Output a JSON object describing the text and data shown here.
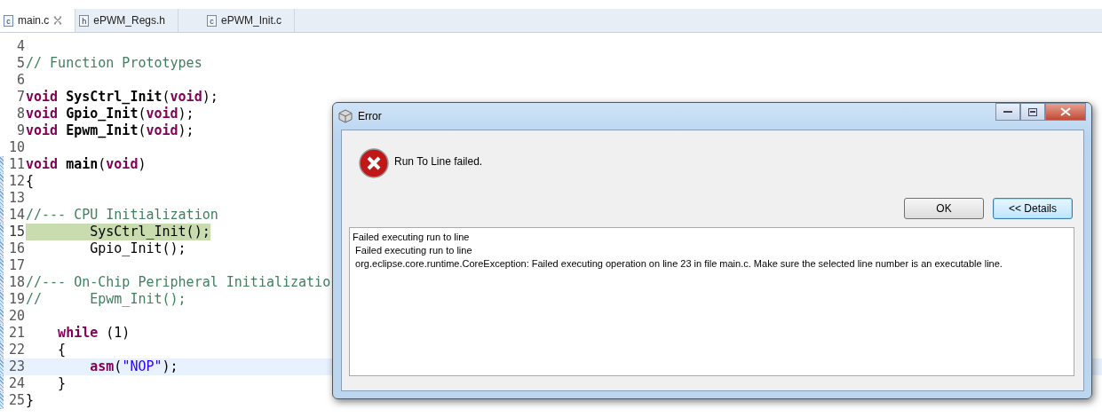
{
  "tabs": [
    {
      "label": "main.c",
      "icon_text": "c",
      "selected": true,
      "closable": true
    },
    {
      "label": "ePWM_Regs.h",
      "icon_text": "h",
      "selected": false,
      "closable": false
    },
    {
      "label": "ePWM_Init.c",
      "icon_text": "c",
      "selected": false,
      "closable": false
    }
  ],
  "editor": {
    "lines": [
      {
        "number": "4",
        "current_line": false,
        "cursor_line": false
      },
      {
        "number": "5",
        "current_line": false,
        "cursor_line": false,
        "segments": [
          {
            "text": "// Function Prototypes",
            "kind": "comment"
          }
        ]
      },
      {
        "number": "6",
        "current_line": false,
        "cursor_line": false
      },
      {
        "number": "7",
        "current_line": false,
        "cursor_line": false,
        "segments": [
          {
            "text": "void",
            "kind": "keyword"
          },
          {
            "text": " SysCtrl_Init",
            "kind": "function"
          },
          {
            "text": "(",
            "kind": "plain"
          },
          {
            "text": "void",
            "kind": "keyword"
          },
          {
            "text": ");",
            "kind": "plain"
          }
        ]
      },
      {
        "number": "8",
        "current_line": false,
        "cursor_line": false,
        "segments": [
          {
            "text": "void",
            "kind": "keyword"
          },
          {
            "text": " Gpio_Init",
            "kind": "function"
          },
          {
            "text": "(",
            "kind": "plain"
          },
          {
            "text": "void",
            "kind": "keyword"
          },
          {
            "text": ");",
            "kind": "plain"
          }
        ]
      },
      {
        "number": "9",
        "current_line": false,
        "cursor_line": false,
        "segments": [
          {
            "text": "void",
            "kind": "keyword"
          },
          {
            "text": " Epwm_Init",
            "kind": "function"
          },
          {
            "text": "(",
            "kind": "plain"
          },
          {
            "text": "void",
            "kind": "keyword"
          },
          {
            "text": ");",
            "kind": "plain"
          }
        ]
      },
      {
        "number": "10",
        "current_line": false,
        "cursor_line": false
      },
      {
        "number": "11",
        "current_line": false,
        "cursor_line": false,
        "segments": [
          {
            "text": "void",
            "kind": "keyword"
          },
          {
            "text": " main",
            "kind": "function"
          },
          {
            "text": "(",
            "kind": "plain"
          },
          {
            "text": "void",
            "kind": "keyword"
          },
          {
            "text": ")",
            "kind": "plain"
          }
        ]
      },
      {
        "number": "12",
        "current_line": false,
        "cursor_line": false,
        "segments": [
          {
            "text": "{",
            "kind": "plain"
          }
        ]
      },
      {
        "number": "13",
        "current_line": false,
        "cursor_line": false
      },
      {
        "number": "14",
        "current_line": false,
        "cursor_line": false,
        "segments": [
          {
            "text": "//--- CPU Initialization",
            "kind": "comment"
          }
        ]
      },
      {
        "number": "15",
        "current_line": true,
        "cursor_line": false,
        "segments": [
          {
            "text": "        SysCtrl_Init();",
            "kind": "plain"
          }
        ]
      },
      {
        "number": "16",
        "current_line": false,
        "cursor_line": false,
        "segments": [
          {
            "text": "        Gpio_Init();",
            "kind": "plain"
          }
        ]
      },
      {
        "number": "17",
        "current_line": false,
        "cursor_line": false
      },
      {
        "number": "18",
        "current_line": false,
        "cursor_line": false,
        "segments": [
          {
            "text": "//--- On-Chip Peripheral Initializatio",
            "kind": "comment"
          }
        ]
      },
      {
        "number": "19",
        "current_line": false,
        "cursor_line": false,
        "segments": [
          {
            "text": "//      Epwm_Init();",
            "kind": "comment"
          }
        ]
      },
      {
        "number": "20",
        "current_line": false,
        "cursor_line": false
      },
      {
        "number": "21",
        "current_line": false,
        "cursor_line": false,
        "segments": [
          {
            "text": "    while",
            "kind": "keyword"
          },
          {
            "text": " (1)",
            "kind": "plain"
          }
        ]
      },
      {
        "number": "22",
        "current_line": false,
        "cursor_line": false,
        "segments": [
          {
            "text": "    {",
            "kind": "plain"
          }
        ]
      },
      {
        "number": "23",
        "current_line": false,
        "cursor_line": true,
        "segments": [
          {
            "text": "        asm",
            "kind": "keyword"
          },
          {
            "text": "(",
            "kind": "plain"
          },
          {
            "text": "\"NOP\"",
            "kind": "string"
          },
          {
            "text": ");",
            "kind": "plain"
          }
        ]
      },
      {
        "number": "24",
        "current_line": false,
        "cursor_line": false,
        "segments": [
          {
            "text": "    }",
            "kind": "plain"
          }
        ]
      },
      {
        "number": "25",
        "current_line": false,
        "cursor_line": false,
        "segments": [
          {
            "text": "}",
            "kind": "plain"
          }
        ]
      }
    ]
  },
  "dialog": {
    "title": "Error",
    "message": "Run To Line failed.",
    "buttons": [
      {
        "label": "OK",
        "selected": false
      },
      {
        "label": "<< Details",
        "selected": true
      }
    ],
    "details": [
      "Failed executing run to line",
      " Failed executing run to line",
      " org.eclipse.core.runtime.CoreException: Failed executing operation on line 23 in file main.c. Make sure the selected line number is an executable line."
    ]
  }
}
